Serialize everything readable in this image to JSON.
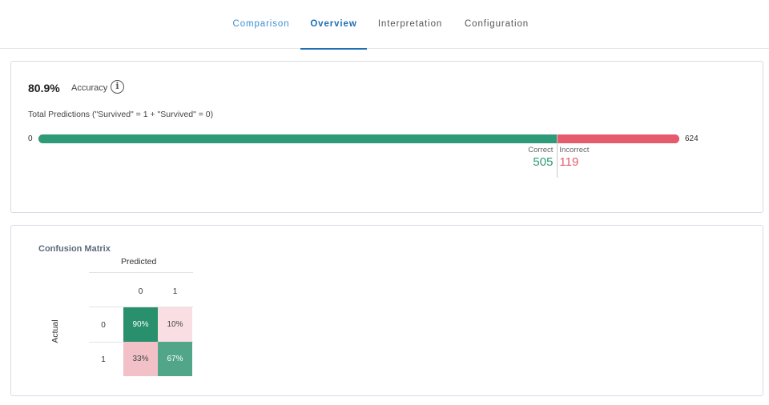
{
  "tabs": {
    "comparison": "Comparison",
    "overview": "Overview",
    "interpretation": "Interpretation",
    "configuration": "Configuration",
    "active": "Overview",
    "active_color": "#1f6fb5"
  },
  "accuracy": {
    "value": "80.9%",
    "label": "Accuracy",
    "info_icon": "info-icon"
  },
  "predictions": {
    "label": "Total Predictions (\"Survived\" = 1 + \"Survived\" = 0)",
    "min": "0",
    "total": "624",
    "correct_label": "Correct",
    "correct_value": "505",
    "incorrect_label": "Incorrect",
    "incorrect_value": "119",
    "correct_color": "#2e9a77",
    "incorrect_color": "#e45b6c"
  },
  "confusion_matrix": {
    "title": "Confusion Matrix",
    "predicted_label": "Predicted",
    "actual_label": "Actual",
    "columns": [
      "0",
      "1"
    ],
    "rows": [
      "0",
      "1"
    ],
    "cells": [
      [
        {
          "text": "90%",
          "value": 0.9
        },
        {
          "text": "10%",
          "value": 0.1
        }
      ],
      [
        {
          "text": "33%",
          "value": 0.33
        },
        {
          "text": "67%",
          "value": 0.67
        }
      ]
    ]
  }
}
